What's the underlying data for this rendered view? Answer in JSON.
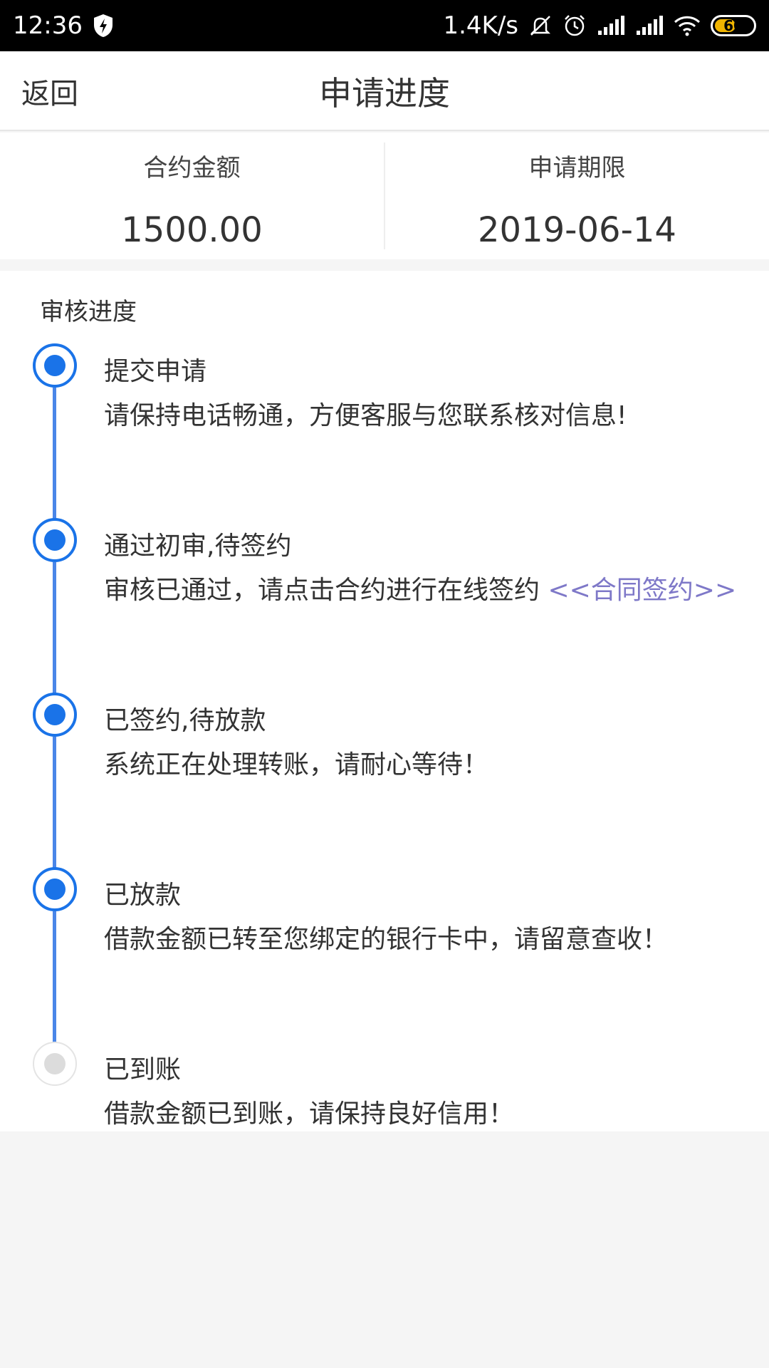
{
  "status_bar": {
    "time": "12:36",
    "net_speed": "1.4K/s",
    "battery": "60",
    "battery_level": 0.6
  },
  "header": {
    "back_label": "返回",
    "title": "申请进度"
  },
  "summary": {
    "amount_label": "合约金额",
    "amount_value": "1500.00",
    "deadline_label": "申请期限",
    "deadline_value": "2019-06-14"
  },
  "progress": {
    "section_title": "审核进度",
    "steps": [
      {
        "title": "提交申请",
        "desc": "请保持电话畅通，方便客服与您联系核对信息!",
        "status": "done"
      },
      {
        "title": "通过初审,待签约",
        "desc": "审核已通过，请点击合约进行在线签约 ",
        "link": "<<合同签约>>",
        "status": "done"
      },
      {
        "title": "已签约,待放款",
        "desc": "系统正在处理转账，请耐心等待！",
        "status": "done"
      },
      {
        "title": "已放款",
        "desc": "借款金额已转至您绑定的银行卡中，请留意查收！",
        "status": "done"
      },
      {
        "title": "已到账",
        "desc": "借款金额已到账，请保持良好信用！",
        "status": "pending"
      }
    ]
  },
  "colors": {
    "accent": "#1a73e8",
    "timeline": "#4a86e8",
    "link": "#7e78c8",
    "pending": "#dcdcdc"
  }
}
